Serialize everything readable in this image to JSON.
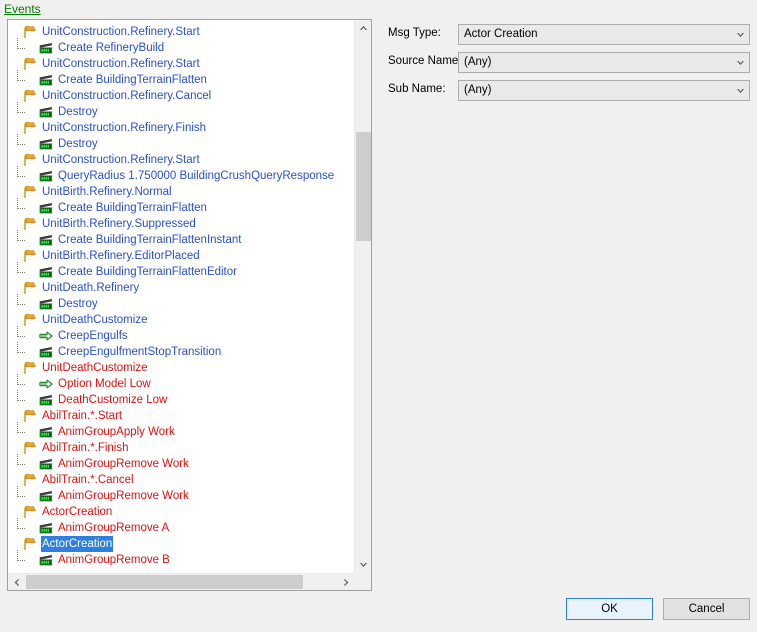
{
  "panel": {
    "events_label": "Events"
  },
  "tree": {
    "nodes": [
      {
        "type": "event",
        "icon": "flag-icon",
        "label": "UnitConstruction.Refinery.Start",
        "color": "blue",
        "selected": false
      },
      {
        "type": "action",
        "icon": "clapper-icon",
        "label": "Create RefineryBuild",
        "color": "blue",
        "selected": false
      },
      {
        "type": "event",
        "icon": "flag-icon",
        "label": "UnitConstruction.Refinery.Start",
        "color": "blue",
        "selected": false
      },
      {
        "type": "action",
        "icon": "clapper-icon",
        "label": "Create BuildingTerrainFlatten",
        "color": "blue",
        "selected": false
      },
      {
        "type": "event",
        "icon": "flag-icon",
        "label": "UnitConstruction.Refinery.Cancel",
        "color": "blue",
        "selected": false
      },
      {
        "type": "action",
        "icon": "clapper-icon",
        "label": "Destroy",
        "color": "blue",
        "selected": false
      },
      {
        "type": "event",
        "icon": "flag-icon",
        "label": "UnitConstruction.Refinery.Finish",
        "color": "blue",
        "selected": false
      },
      {
        "type": "action",
        "icon": "clapper-icon",
        "label": "Destroy",
        "color": "blue",
        "selected": false
      },
      {
        "type": "event",
        "icon": "flag-icon",
        "label": "UnitConstruction.Refinery.Start",
        "color": "blue",
        "selected": false
      },
      {
        "type": "action",
        "icon": "clapper-icon",
        "label": "QueryRadius 1.750000 BuildingCrushQueryResponse",
        "color": "blue",
        "selected": false
      },
      {
        "type": "event",
        "icon": "flag-icon",
        "label": "UnitBirth.Refinery.Normal",
        "color": "blue",
        "selected": false
      },
      {
        "type": "action",
        "icon": "clapper-icon",
        "label": "Create BuildingTerrainFlatten",
        "color": "blue",
        "selected": false
      },
      {
        "type": "event",
        "icon": "flag-icon",
        "label": "UnitBirth.Refinery.Suppressed",
        "color": "blue",
        "selected": false
      },
      {
        "type": "action",
        "icon": "clapper-icon",
        "label": "Create BuildingTerrainFlattenInstant",
        "color": "blue",
        "selected": false
      },
      {
        "type": "event",
        "icon": "flag-icon",
        "label": "UnitBirth.Refinery.EditorPlaced",
        "color": "blue",
        "selected": false
      },
      {
        "type": "action",
        "icon": "clapper-icon",
        "label": "Create BuildingTerrainFlattenEditor",
        "color": "blue",
        "selected": false
      },
      {
        "type": "event",
        "icon": "flag-icon",
        "label": "UnitDeath.Refinery",
        "color": "blue",
        "selected": false
      },
      {
        "type": "action",
        "icon": "clapper-icon",
        "label": "Destroy",
        "color": "blue",
        "selected": false
      },
      {
        "type": "event",
        "icon": "flag-icon",
        "label": "UnitDeathCustomize",
        "color": "blue",
        "selected": false
      },
      {
        "type": "action",
        "icon": "arrow-icon",
        "label": "CreepEngulfs",
        "color": "blue",
        "selected": false
      },
      {
        "type": "action",
        "icon": "clapper-icon",
        "label": "CreepEngulfmentStopTransition",
        "color": "blue",
        "selected": false
      },
      {
        "type": "event",
        "icon": "flag-icon",
        "label": "UnitDeathCustomize",
        "color": "red",
        "selected": false
      },
      {
        "type": "action",
        "icon": "arrow-icon",
        "label": "Option Model Low",
        "color": "red",
        "selected": false
      },
      {
        "type": "action",
        "icon": "clapper-icon",
        "label": "DeathCustomize Low",
        "color": "red",
        "selected": false
      },
      {
        "type": "event",
        "icon": "flag-icon",
        "label": "AbilTrain.*.Start",
        "color": "red",
        "selected": false
      },
      {
        "type": "action",
        "icon": "clapper-icon",
        "label": "AnimGroupApply Work",
        "color": "red",
        "selected": false
      },
      {
        "type": "event",
        "icon": "flag-icon",
        "label": "AbilTrain.*.Finish",
        "color": "red",
        "selected": false
      },
      {
        "type": "action",
        "icon": "clapper-icon",
        "label": "AnimGroupRemove Work",
        "color": "red",
        "selected": false
      },
      {
        "type": "event",
        "icon": "flag-icon",
        "label": "AbilTrain.*.Cancel",
        "color": "red",
        "selected": false
      },
      {
        "type": "action",
        "icon": "clapper-icon",
        "label": "AnimGroupRemove Work",
        "color": "red",
        "selected": false
      },
      {
        "type": "event",
        "icon": "flag-icon",
        "label": "ActorCreation",
        "color": "red",
        "selected": false
      },
      {
        "type": "action",
        "icon": "clapper-icon",
        "label": "AnimGroupRemove A",
        "color": "red",
        "selected": false
      },
      {
        "type": "event",
        "icon": "flag-icon",
        "label": "ActorCreation",
        "color": "red",
        "selected": true
      },
      {
        "type": "action",
        "icon": "clapper-icon",
        "label": "AnimGroupRemove B",
        "color": "red",
        "selected": false
      }
    ]
  },
  "form": {
    "rows": [
      {
        "label": "Msg Type:",
        "value": "Actor Creation",
        "icon": "chevron-down-icon"
      },
      {
        "label": "Source Name:",
        "value": "(Any)",
        "icon": "chevron-down-icon"
      },
      {
        "label": "Sub Name:",
        "value": "(Any)",
        "icon": "chevron-down-icon"
      }
    ]
  },
  "buttons": {
    "ok": "OK",
    "cancel": "Cancel"
  },
  "colors": {
    "selection": "#2f7fe0",
    "event_blue": "#2a4fd0",
    "event_red": "#e01010",
    "label_green": "#007a00",
    "window_bg": "#f0f0f0"
  }
}
